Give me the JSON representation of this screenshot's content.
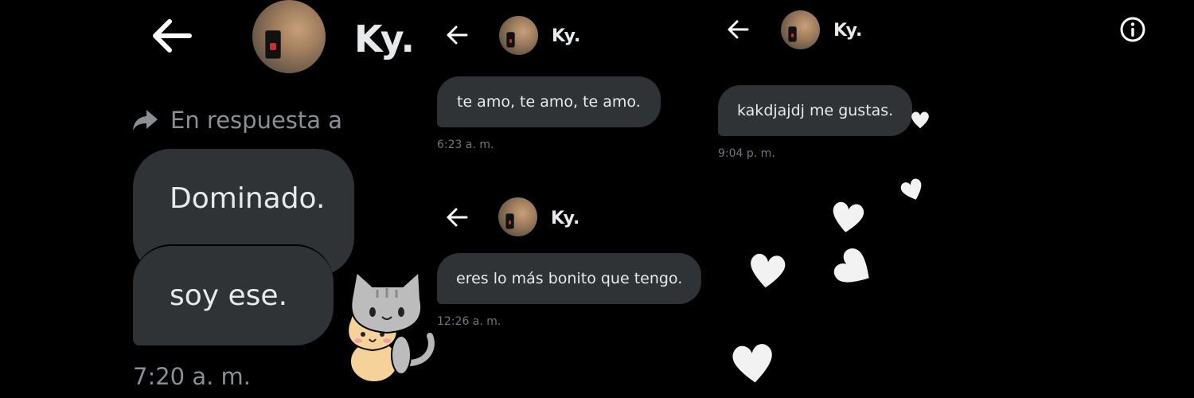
{
  "contact": {
    "name": "Ky."
  },
  "panels": {
    "left": {
      "reply_label": "En respuesta a",
      "messages": [
        "Dominado.",
        "soy ese."
      ],
      "time": "7:20 a. m."
    },
    "middle_top": {
      "message": "te amo, te amo, te amo.",
      "time": "6:23 a. m."
    },
    "middle_bottom": {
      "message": "eres lo más bonito que tengo.",
      "time": "12:26 a. m."
    },
    "right": {
      "message": "kakdjajdj me gustas.",
      "time": "9:04 p. m."
    }
  },
  "icons": {
    "back": "back-arrow-icon",
    "reply": "reply-arrow-icon",
    "info": "info-icon"
  },
  "colors": {
    "background": "#000000",
    "bubble": "#2f3336",
    "text": "#e7e9ea",
    "timestamp": "#71767b"
  }
}
